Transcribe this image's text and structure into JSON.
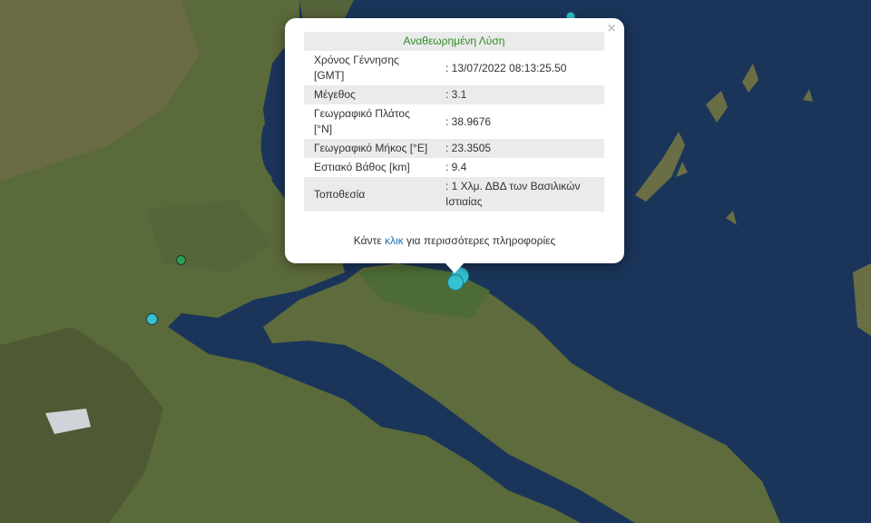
{
  "popup": {
    "title": "Αναθεωρημένη Λύση",
    "close_label": "×",
    "rows": [
      {
        "label": "Χρόνος Γέννησης [GMT]",
        "value": ": 13/07/2022 08:13:25.50"
      },
      {
        "label": "Μέγεθος",
        "value": ": 3.1"
      },
      {
        "label": "Γεωγραφικό Πλάτος [°N]",
        "value": ": 38.9676"
      },
      {
        "label": "Γεωγραφικό Μήκος [°E]",
        "value": ": 23.3505"
      },
      {
        "label": "Εστιακό Βάθος [km]",
        "value": ": 9.4"
      },
      {
        "label": "Τοποθεσία",
        "value": ": 1 Χλμ. ΔΒΔ των Βασιλικών Ιστιαίας"
      }
    ],
    "more_prefix": "Κάντε ",
    "more_link": "κλικ",
    "more_suffix": " για περισσότερες πληροφορίες"
  },
  "markers": [
    {
      "color": "#36c0d0",
      "type": "recent-earthquake"
    },
    {
      "color": "#36c0d0",
      "type": "recent-earthquake"
    },
    {
      "color": "#36c0d0",
      "type": "recent-earthquake"
    },
    {
      "color": "#36c0d0",
      "type": "recent-earthquake"
    },
    {
      "color": "#2e9e52",
      "type": "older-earthquake"
    }
  ],
  "colors": {
    "sea": "#1a3457",
    "land": "#5a6a3c",
    "popup_title": "#2e8b22",
    "link": "#1f6fb4"
  }
}
